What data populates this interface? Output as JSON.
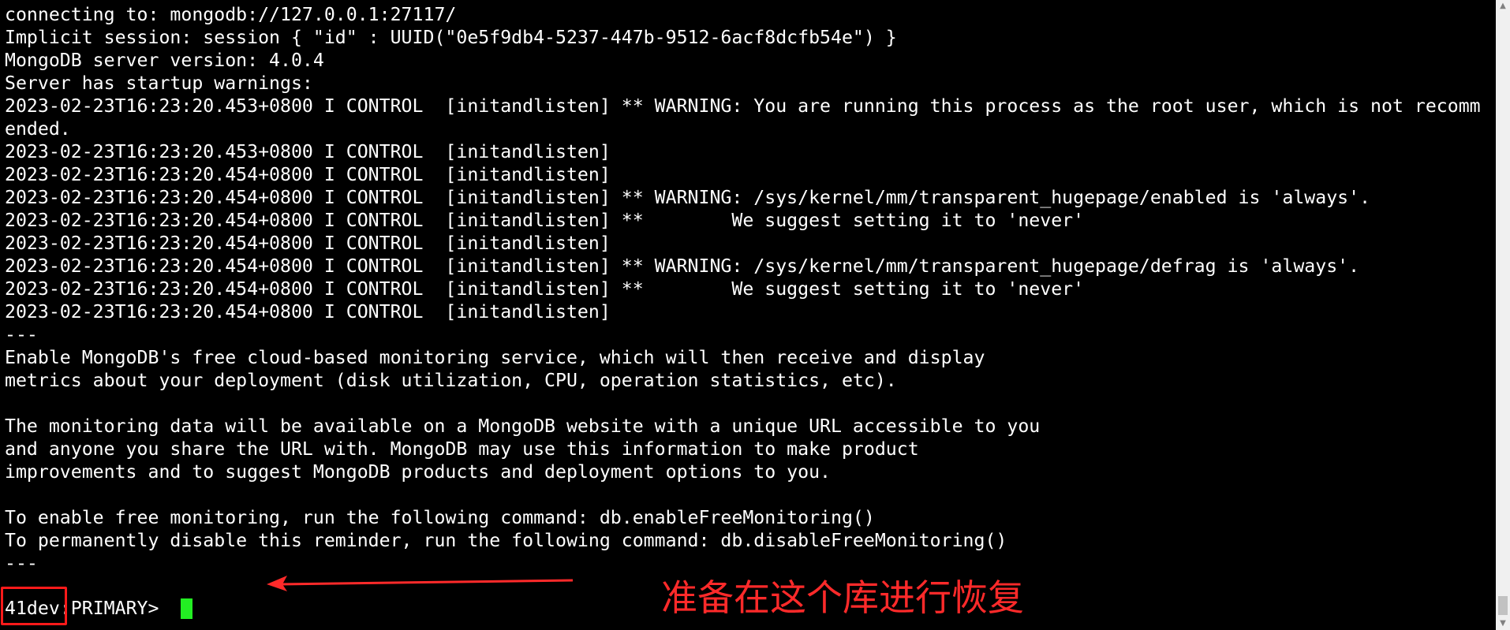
{
  "terminal": {
    "lines": [
      "connecting to: mongodb://127.0.0.1:27117/",
      "Implicit session: session { \"id\" : UUID(\"0e5f9db4-5237-447b-9512-6acf8dcfb54e\") }",
      "MongoDB server version: 4.0.4",
      "Server has startup warnings:",
      "2023-02-23T16:23:20.453+0800 I CONTROL  [initandlisten] ** WARNING: You are running this process as the root user, which is not recomm",
      "ended.",
      "2023-02-23T16:23:20.453+0800 I CONTROL  [initandlisten]",
      "2023-02-23T16:23:20.454+0800 I CONTROL  [initandlisten]",
      "2023-02-23T16:23:20.454+0800 I CONTROL  [initandlisten] ** WARNING: /sys/kernel/mm/transparent_hugepage/enabled is 'always'.",
      "2023-02-23T16:23:20.454+0800 I CONTROL  [initandlisten] **        We suggest setting it to 'never'",
      "2023-02-23T16:23:20.454+0800 I CONTROL  [initandlisten]",
      "2023-02-23T16:23:20.454+0800 I CONTROL  [initandlisten] ** WARNING: /sys/kernel/mm/transparent_hugepage/defrag is 'always'.",
      "2023-02-23T16:23:20.454+0800 I CONTROL  [initandlisten] **        We suggest setting it to 'never'",
      "2023-02-23T16:23:20.454+0800 I CONTROL  [initandlisten]",
      "---",
      "Enable MongoDB's free cloud-based monitoring service, which will then receive and display",
      "metrics about your deployment (disk utilization, CPU, operation statistics, etc).",
      "",
      "The monitoring data will be available on a MongoDB website with a unique URL accessible to you",
      "and anyone you share the URL with. MongoDB may use this information to make product",
      "improvements and to suggest MongoDB products and deployment options to you.",
      "",
      "To enable free monitoring, run the following command: db.enableFreeMonitoring()",
      "To permanently disable this reminder, run the following command: db.disableFreeMonitoring()",
      "---"
    ],
    "prompt": {
      "replset": "41dev",
      "separator": ":",
      "state": "PRIMARY",
      "symbol": "> "
    },
    "cursor_color": "#23ee23"
  },
  "annotation": {
    "text": "准备在这个库进行恢复",
    "color": "#ff2a2a"
  },
  "scrollbar": {
    "up_icon": "scroll-up-arrow-icon",
    "down_icon": "scroll-down-arrow-icon"
  }
}
